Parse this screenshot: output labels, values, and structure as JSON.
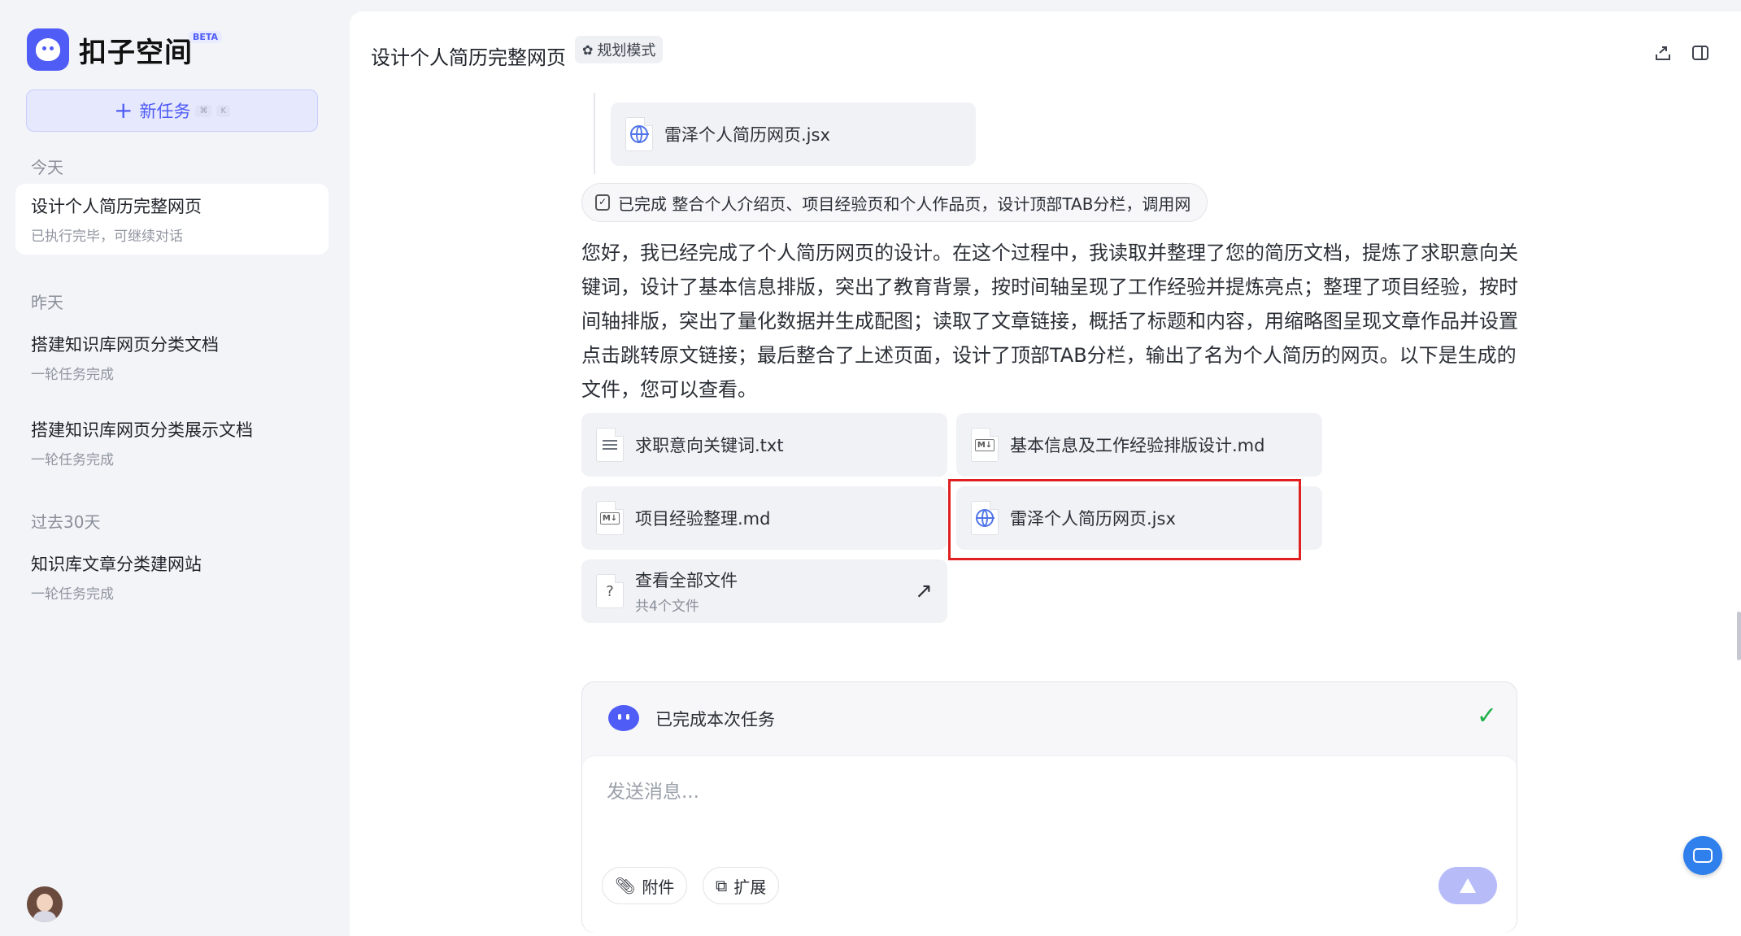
{
  "app": {
    "name": "扣子空间",
    "beta": "BETA",
    "brand_color": "#4f5cf5"
  },
  "sidebar": {
    "new_task_label": "新任务",
    "shortcut_keys": [
      "⌘",
      "K"
    ],
    "groups": [
      {
        "label": "今天",
        "items": [
          {
            "title": "设计个人简历完整网页",
            "subtitle": "已执行完毕，可继续对话",
            "active": true
          }
        ]
      },
      {
        "label": "昨天",
        "items": [
          {
            "title": "搭建知识库网页分类文档",
            "subtitle": "一轮任务完成"
          },
          {
            "title": "搭建知识库网页分类展示文档",
            "subtitle": "一轮任务完成"
          }
        ]
      },
      {
        "label": "过去30天",
        "items": [
          {
            "title": "知识库文章分类建网站",
            "subtitle": "一轮任务完成"
          }
        ]
      }
    ]
  },
  "header": {
    "title": "设计个人简历完整网页",
    "mode_badge": "规划模式",
    "share_icon": "share-icon",
    "panel_icon": "panel-toggle-icon"
  },
  "thread": {
    "prev_file": {
      "name": "雷泽个人简历网页.jsx",
      "icon": "globe-icon"
    },
    "status_pill": "已完成 整合个人介绍页、项目经验页和个人作品页，设计顶部TAB分栏，调用网",
    "summary": "您好，我已经完成了个人简历网页的设计。在这个过程中，我读取并整理了您的简历文档，提炼了求职意向关键词，设计了基本信息排版，突出了教育背景，按时间轴呈现了工作经验并提炼亮点；整理了项目经验，按时间轴排版，突出了量化数据并生成配图；读取了文章链接，概括了标题和内容，用缩略图呈现文章作品并设置点击跳转原文链接；最后整合了上述页面，设计了顶部TAB分栏，输出了名为个人简历的网页。以下是生成的文件，您可以查看。",
    "files": [
      {
        "name": "求职意向关键词.txt",
        "icon": "text-file-icon"
      },
      {
        "name": "基本信息及工作经验排版设计.md",
        "icon": "markdown-file-icon"
      },
      {
        "name": "项目经验整理.md",
        "icon": "markdown-file-icon"
      },
      {
        "name": "雷泽个人简历网页.jsx",
        "icon": "globe-icon"
      }
    ],
    "view_all": {
      "title": "查看全部文件",
      "subtitle": "共4个文件"
    }
  },
  "composer": {
    "status_text": "已完成本次任务",
    "placeholder": "发送消息...",
    "attach_label": "附件",
    "extend_label": "扩展",
    "success_color": "#22b14c"
  },
  "highlight_color": "#e02020"
}
